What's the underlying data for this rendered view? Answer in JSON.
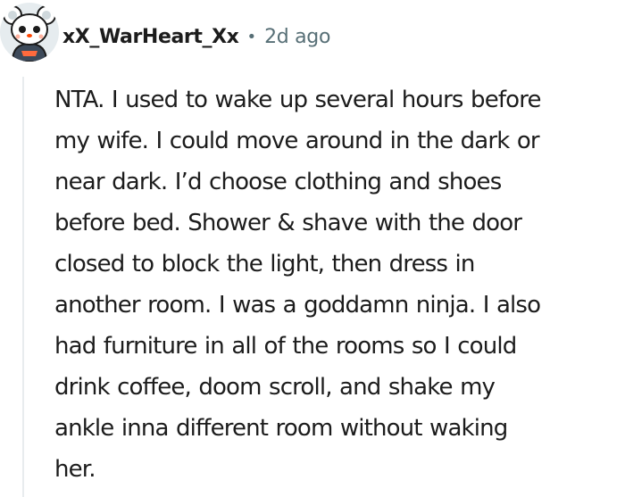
{
  "comment": {
    "avatar_icon": "reddit-snoo-avatar-icon",
    "username": "xX_WarHeart_Xx",
    "separator": "•",
    "timestamp": "2d ago",
    "body_lines": [
      "NTA. I used to wake up several hours before",
      "my wife. I could move around in the dark or",
      "near dark. I’d choose clothing and shoes",
      "before bed. Shower & shave with the door",
      "closed to block the light, then dress in",
      "another room. I was a goddamn ninja. I also",
      "had furniture in all of the rooms so I could",
      "drink coffee, doom scroll, and shake my",
      "ankle inna different room without waking",
      "her."
    ]
  },
  "colors": {
    "text": "#1c1c1c",
    "meta": "#576f76",
    "thread_line": "#e8ecee",
    "avatar_bg": "#e6ecef"
  }
}
